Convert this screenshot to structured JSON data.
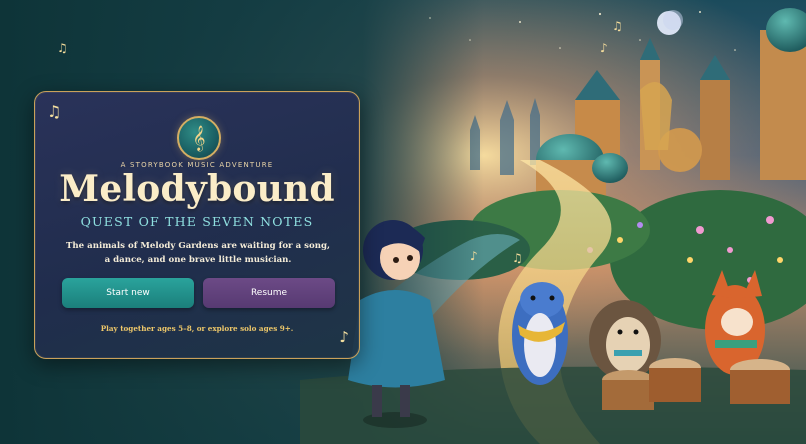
{
  "title_card": {
    "kicker": "A STORYBOOK MUSIC ADVENTURE",
    "title": "Melodybound",
    "subtitle": "QUEST OF THE SEVEN NOTES",
    "blurb": "The animals of Melody Gardens are waiting for a song, a dance, and one brave little musician.",
    "ages_note": "Play together ages 5–8, or explore solo ages 9+."
  },
  "buttons": {
    "start_new": "Start new",
    "resume": "Resume"
  },
  "icons": {
    "emblem": "treble-clef-icon",
    "decorations": [
      "music-note-icon",
      "music-note-icon"
    ]
  },
  "colors": {
    "panel_border": "#caa15a",
    "title": "#fbedc8",
    "subtitle": "#8fe0e0",
    "start_button": "#1f8c86",
    "resume_button": "#5f3f7a",
    "ages_note": "#eec86a"
  },
  "scene": {
    "characters": [
      "girl-musician",
      "otter",
      "hedgehog",
      "fox-drummer"
    ]
  }
}
